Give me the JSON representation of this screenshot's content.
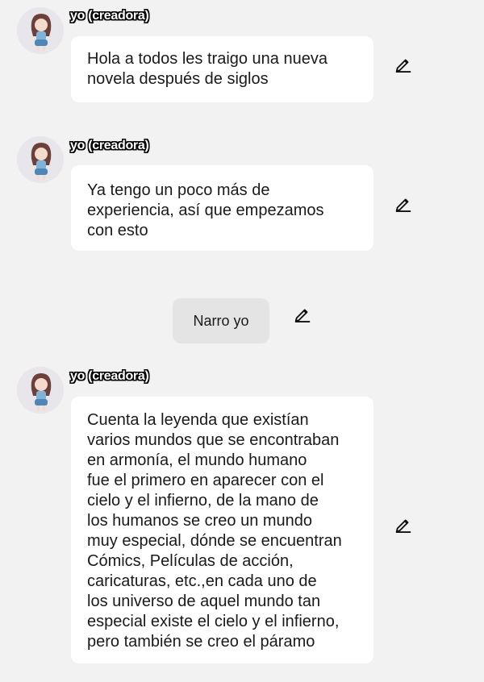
{
  "messages": [
    {
      "author": "yo (creadora)",
      "text": "Hola a todos les traigo una nueva\nnovela después de siglos"
    },
    {
      "author": "yo (creadora)",
      "text": "Ya tengo un poco más de\nexperiencia, así que empezamos\ncon esto"
    },
    {
      "author": "yo (creadora)",
      "text": "Cuenta la leyenda que existían\nvarios mundos que se encontraban\nen armonía, el mundo humano\nfue el primero en aparecer con el\ncielo y el infierno, de la mano de\nlos humanos se creo un mundo\nmuy especial, dónde se encuentran\nCómics, Películas de acción,\ncaricaturas, etc.,en cada uno de\nlos universo de aquel mundo tan\nespecial existe el cielo y el infierno,\npero también se creo el páramo"
    }
  ],
  "narration": {
    "text": "Narro yo"
  },
  "icons": {
    "edit": "pencil-edit-icon",
    "avatar": "avatar-girl-illustration"
  },
  "colors": {
    "background": "#f2f2f2",
    "bubble": "#ffffff",
    "narration_bubble": "#e4e4e4",
    "text": "#1a1a1a"
  }
}
